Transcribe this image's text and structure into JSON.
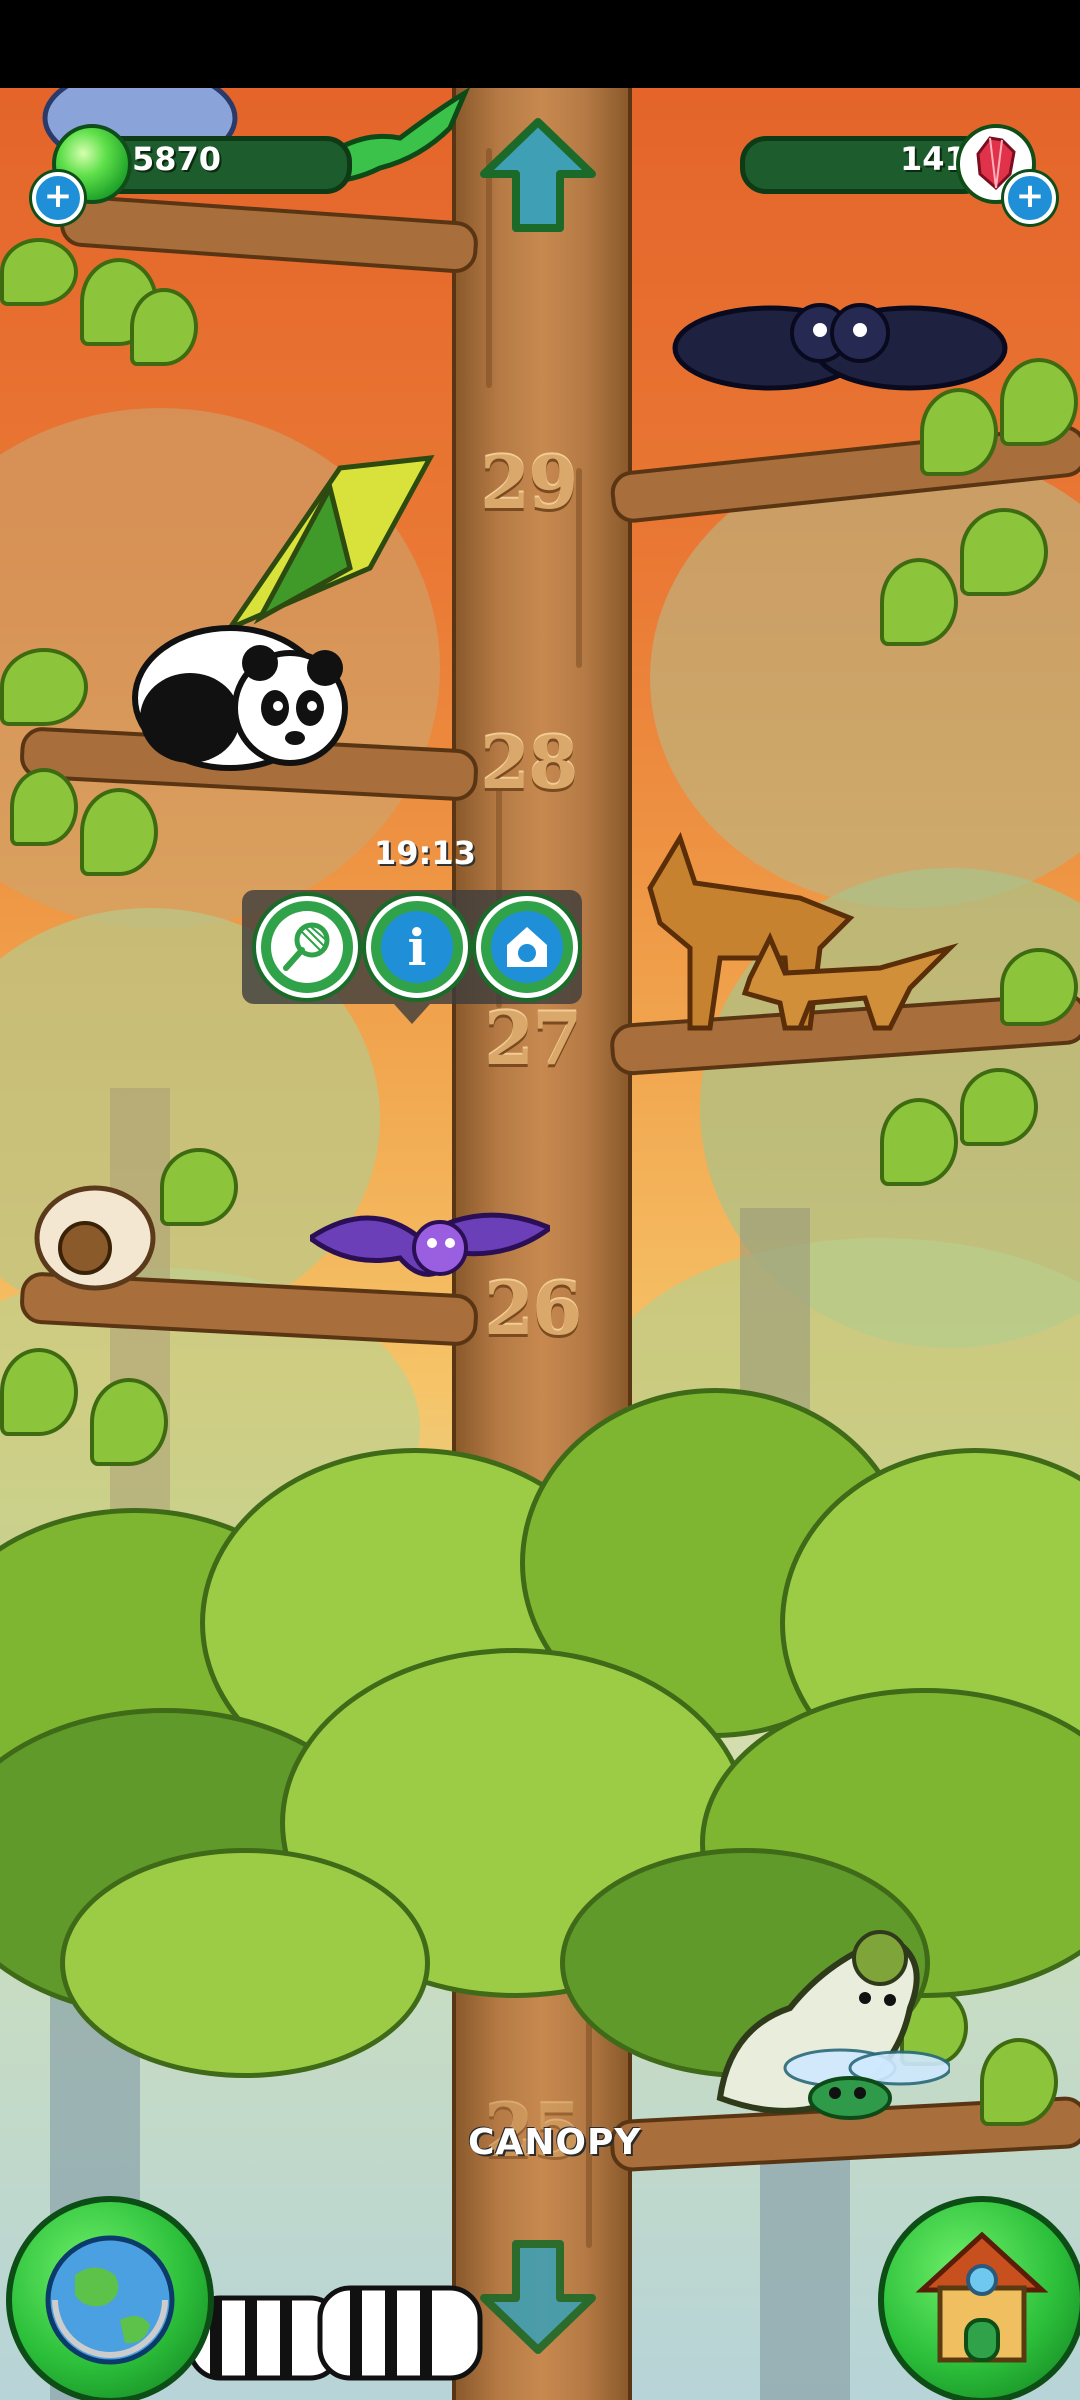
{
  "hud": {
    "gems_value": "5870",
    "crystals_value": "141",
    "gems_icon": "green-gem-icon",
    "crystals_icon": "red-crystal-icon",
    "add_icon": "plus-icon"
  },
  "tower": {
    "floors": [
      "29",
      "28",
      "27",
      "26"
    ],
    "partial_floor_bottom": "25",
    "current_floor_label": "CANOPY"
  },
  "selected_animal": {
    "timer": "19:13",
    "actions": [
      {
        "name": "catch",
        "icon": "net-icon"
      },
      {
        "name": "info",
        "icon": "info-icon"
      },
      {
        "name": "send-home",
        "icon": "pet-house-icon"
      }
    ]
  },
  "buttons": {
    "up_icon": "arrow-up-icon",
    "down_icon": "arrow-down-icon",
    "world_icon": "globe-icon",
    "home_icon": "house-icon"
  },
  "colors": {
    "sky_top": "#e4642a",
    "trunk": "#c7894f",
    "foliage": "#7fb631",
    "hud_bar": "#1d5c2c"
  }
}
